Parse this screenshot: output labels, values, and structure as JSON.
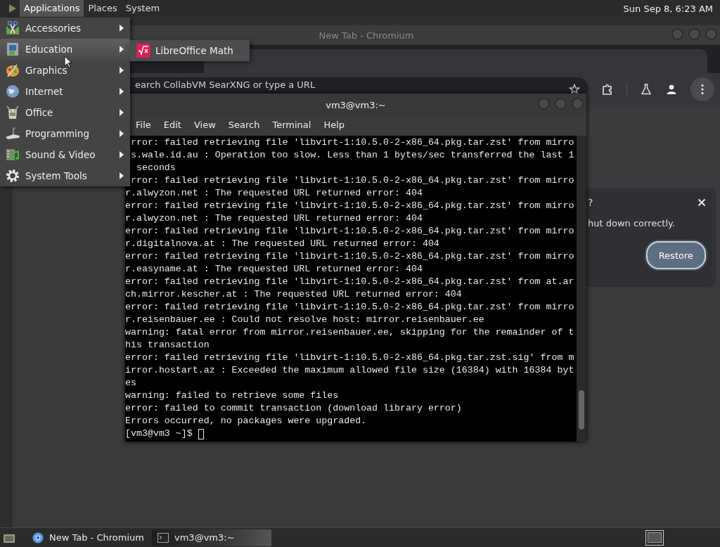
{
  "top_panel": {
    "menus": [
      {
        "label": "Applications",
        "selected": true
      },
      {
        "label": "Places",
        "selected": false
      },
      {
        "label": "System",
        "selected": false
      }
    ],
    "clock": "Sun Sep  8, 6:23 AM"
  },
  "applications_menu": {
    "items": [
      {
        "label": "Accessories",
        "selected": false
      },
      {
        "label": "Education",
        "selected": true
      },
      {
        "label": "Graphics",
        "selected": false
      },
      {
        "label": "Internet",
        "selected": false
      },
      {
        "label": "Office",
        "selected": false
      },
      {
        "label": "Programming",
        "selected": false
      },
      {
        "label": "Sound & Video",
        "selected": false
      },
      {
        "label": "System Tools",
        "selected": false
      }
    ]
  },
  "submenu": {
    "items": [
      {
        "label": "LibreOffice Math"
      }
    ]
  },
  "chromium": {
    "title": "New Tab - Chromium",
    "omnibox": {
      "placeholder": "earch CollabVM SearXNG or type a URL"
    },
    "restore_bubble": {
      "title": "?",
      "message": "hut down correctly.",
      "button": "Restore"
    }
  },
  "terminal": {
    "title": "vm3@vm3:~",
    "menus": [
      "File",
      "Edit",
      "View",
      "Search",
      "Terminal",
      "Help"
    ],
    "lines": [
      " rror: failed retrieving file 'libvirt-1:10.5.0-2-x86_64.pkg.tar.zst' from mirro",
      " s.wale.id.au : Operation too slow. Less than 1 bytes/sec transferred the last 1",
      "  seconds",
      " rror: failed retrieving file 'libvirt-1:10.5.0-2-x86_64.pkg.tar.zst' from mirro",
      "r.alwyzon.net : The requested URL returned error: 404",
      "error: failed retrieving file 'libvirt-1:10.5.0-2-x86_64.pkg.tar.zst' from mirro",
      "r.alwyzon.net : The requested URL returned error: 404",
      "error: failed retrieving file 'libvirt-1:10.5.0-2-x86_64.pkg.tar.zst' from mirro",
      "r.digitalnova.at : The requested URL returned error: 404",
      "error: failed retrieving file 'libvirt-1:10.5.0-2-x86_64.pkg.tar.zst' from mirro",
      "r.easyname.at : The requested URL returned error: 404",
      "error: failed retrieving file 'libvirt-1:10.5.0-2-x86_64.pkg.tar.zst' from at.ar",
      "ch.mirror.kescher.at : The requested URL returned error: 404",
      "error: failed retrieving file 'libvirt-1:10.5.0-2-x86_64.pkg.tar.zst' from mirro",
      "r.reisenbauer.ee : Could not resolve host: mirror.reisenbauer.ee",
      "warning: fatal error from mirror.reisenbauer.ee, skipping for the remainder of t",
      "his transaction",
      "error: failed retrieving file 'libvirt-1:10.5.0-2-x86_64.pkg.tar.zst.sig' from m",
      "irror.hostart.az : Exceeded the maximum allowed file size (16384) with 16384 byt",
      "es",
      "warning: failed to retrieve some files",
      "error: failed to commit transaction (download library error)",
      "Errors occurred, no packages were upgraded."
    ],
    "prompt": "[vm3@vm3 ~]$"
  },
  "taskbar": {
    "tasks": [
      {
        "label": "New Tab - Chromium",
        "selected": false
      },
      {
        "label": "vm3@vm3:~",
        "selected": true
      }
    ]
  }
}
